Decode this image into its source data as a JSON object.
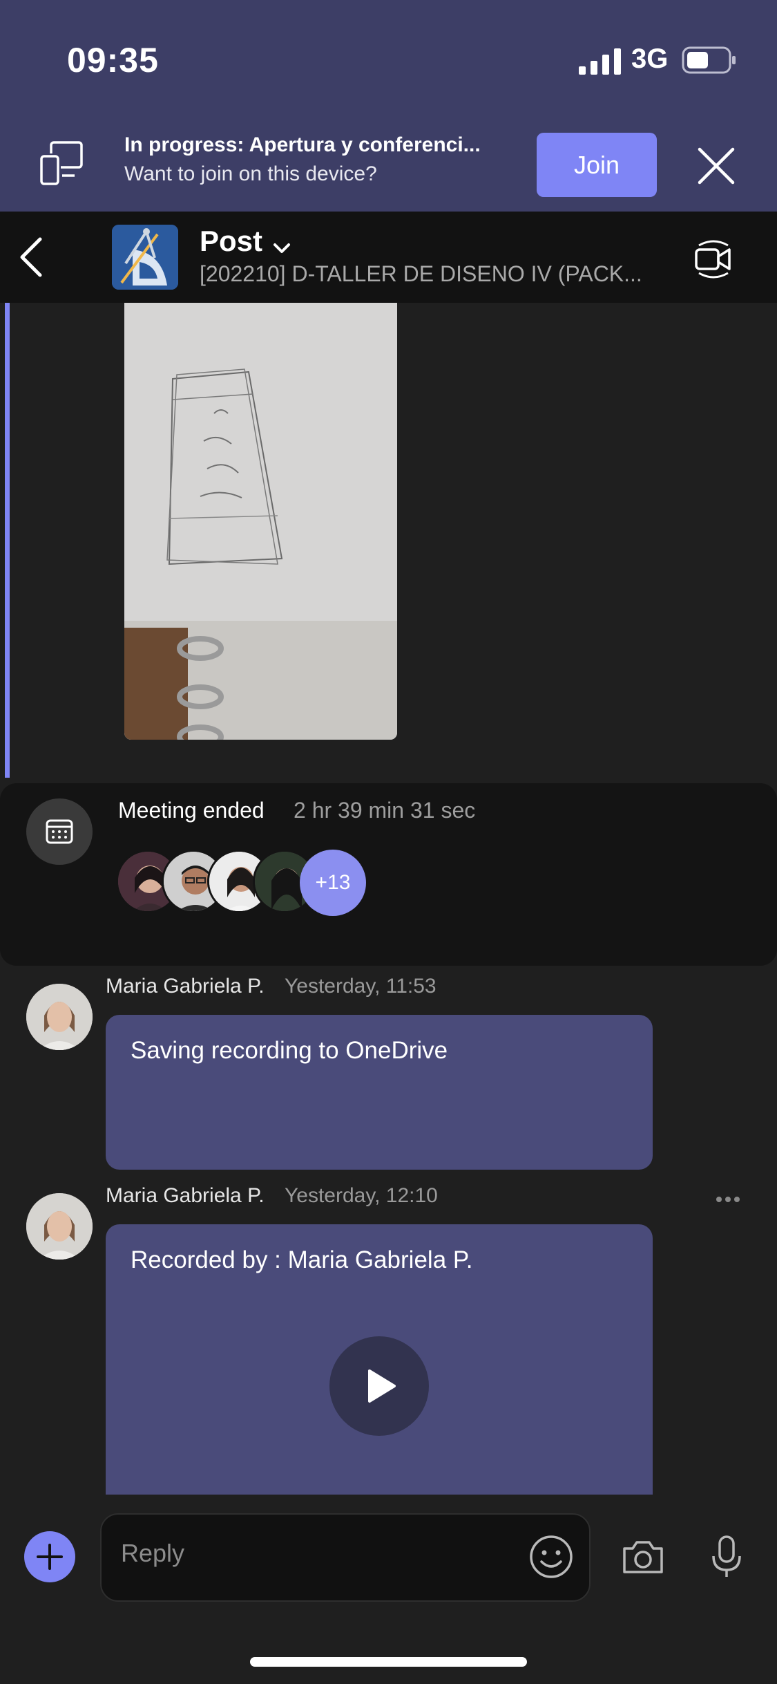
{
  "status_bar": {
    "time": "09:35",
    "network": "3G"
  },
  "banner": {
    "title": "In progress: Apertura y conferenci...",
    "subtitle": "Want to join on this device?",
    "join_label": "Join",
    "close_icon": "close-icon"
  },
  "header": {
    "title": "Post",
    "channel": "[202210] D-TALLER DE DISENO IV (PACK...",
    "back_icon": "chevron-left-icon",
    "meet_icon": "video-camera-icon"
  },
  "meeting": {
    "status": "Meeting ended",
    "duration": "2 hr 39 min 31 sec",
    "extra_participants": "+13"
  },
  "messages": [
    {
      "author": "Maria Gabriela P.",
      "time": "Yesterday, 11:53",
      "text": "Saving recording to OneDrive"
    },
    {
      "author": "Maria Gabriela P.",
      "time": "Yesterday, 12:10",
      "text": "Recorded by : Maria Gabriela P."
    }
  ],
  "composer": {
    "placeholder": "Reply"
  },
  "colors": {
    "accent": "#7f85f5",
    "banner_bg": "#3d3e66",
    "bubble": "#4a4b7a",
    "background": "#1f1f1f"
  }
}
